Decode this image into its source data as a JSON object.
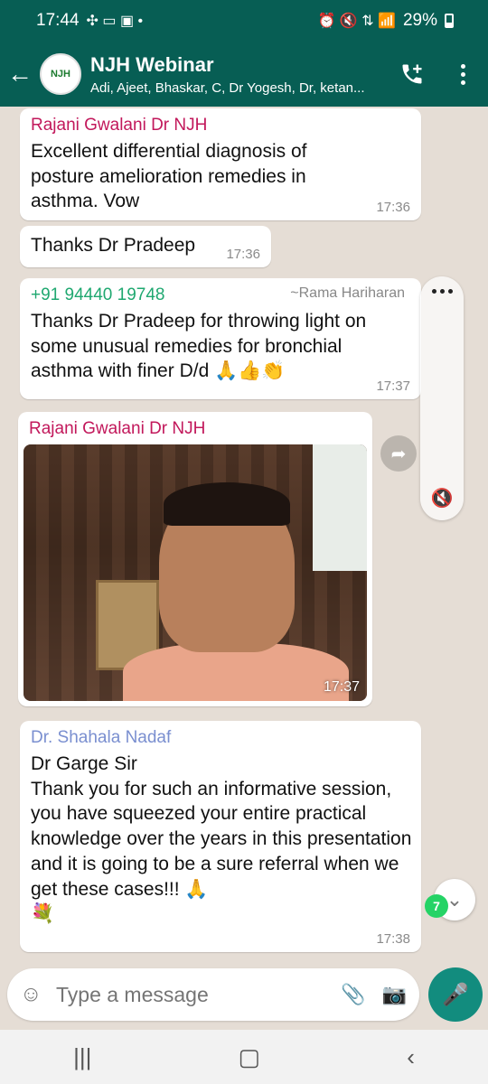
{
  "status_bar": {
    "time": "17:44",
    "battery": "29%"
  },
  "header": {
    "avatar_text": "NJH",
    "title": "NJH Webinar",
    "subtitle": "Adi, Ajeet, Bhaskar, C, Dr Yogesh, Dr, ketan..."
  },
  "messages": [
    {
      "sender": "Rajani Gwalani Dr NJH",
      "sender_color": "#c2185b",
      "text": "Excellent differential diagnosis of posture amelioration remedies in asthma. Vow",
      "time": "17:36"
    },
    {
      "text": "Thanks Dr Pradeep",
      "time": "17:36"
    },
    {
      "sender": "+91 94440 19748",
      "sender_color": "#1fa870",
      "alias": "~Rama Hariharan",
      "text": "Thanks Dr Pradeep for throwing light on some unusual remedies for bronchial asthma with finer D/d 🙏👍👏",
      "time": "17:37"
    },
    {
      "sender": "Rajani Gwalani Dr NJH",
      "sender_color": "#c2185b",
      "media_time": "17:37"
    },
    {
      "sender": "Dr. Shahala Nadaf",
      "sender_color": "#7a8fd0",
      "text": "Dr Garge Sir\nThank you for such an informative session,  you have squeezed  your entire practical knowledge over the years in this presentation and it is going to be a sure referral when we get these cases!!! 🙏\n💐",
      "time": "17:38"
    }
  ],
  "unread_count": "7",
  "input": {
    "placeholder": "Type a message"
  }
}
